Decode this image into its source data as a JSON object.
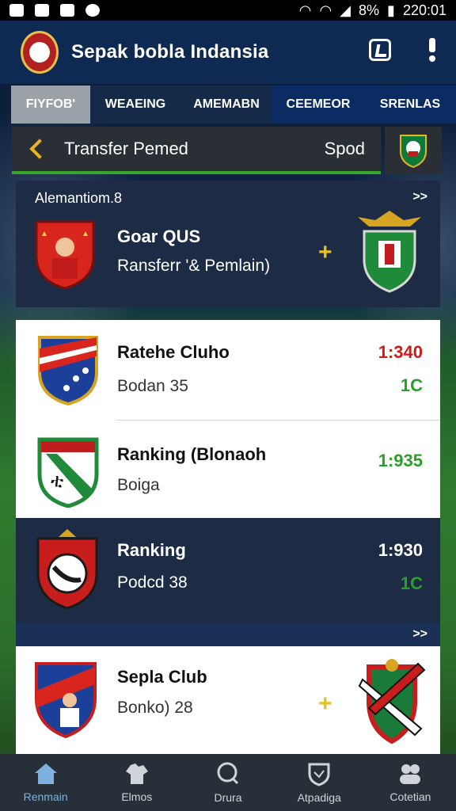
{
  "status_bar": {
    "battery": "8%",
    "time": "220:01"
  },
  "header": {
    "title": "Sepak bobla Indansia"
  },
  "tabs": [
    {
      "label": "FIYFOB'"
    },
    {
      "label": "WEAEING"
    },
    {
      "label": "AMEMABN"
    },
    {
      "label": "CEEMEOR"
    },
    {
      "label": "SRENLAS"
    }
  ],
  "transfer": {
    "title": "Transfer Pemed",
    "speed_label": "Spod"
  },
  "featured": {
    "section": "Alemantiom.8",
    "more": ">>",
    "name": "Goar QUS",
    "subtitle": "Ransferr '& Pemlain)"
  },
  "list": [
    {
      "name": "Ratehe Cluho",
      "sub": "Bodan 35",
      "value": "1:340",
      "trend": "1C"
    },
    {
      "name": "Ranking (Blonaoh",
      "sub": "Boiga",
      "value": "1:935",
      "trend": ""
    },
    {
      "name": "Ranking",
      "sub": "Podcd 38",
      "value": "1:930",
      "trend": "1C"
    }
  ],
  "second": {
    "more": ">>",
    "name": "Sepla Club",
    "sub": "Bonko) 28"
  },
  "nav": [
    {
      "label": "Renmain",
      "icon": "home-icon"
    },
    {
      "label": "Elmos",
      "icon": "shirt-icon"
    },
    {
      "label": "Drura",
      "icon": "search-icon"
    },
    {
      "label": "Atpadiga",
      "icon": "shield-icon"
    },
    {
      "label": "Cotetian",
      "icon": "people-icon"
    }
  ],
  "colors": {
    "header": "#0e2a52",
    "accent_green": "#3aa629",
    "accent_yellow": "#e8c21b",
    "value_red": "#d11b1b",
    "value_green": "#2aa02a"
  }
}
